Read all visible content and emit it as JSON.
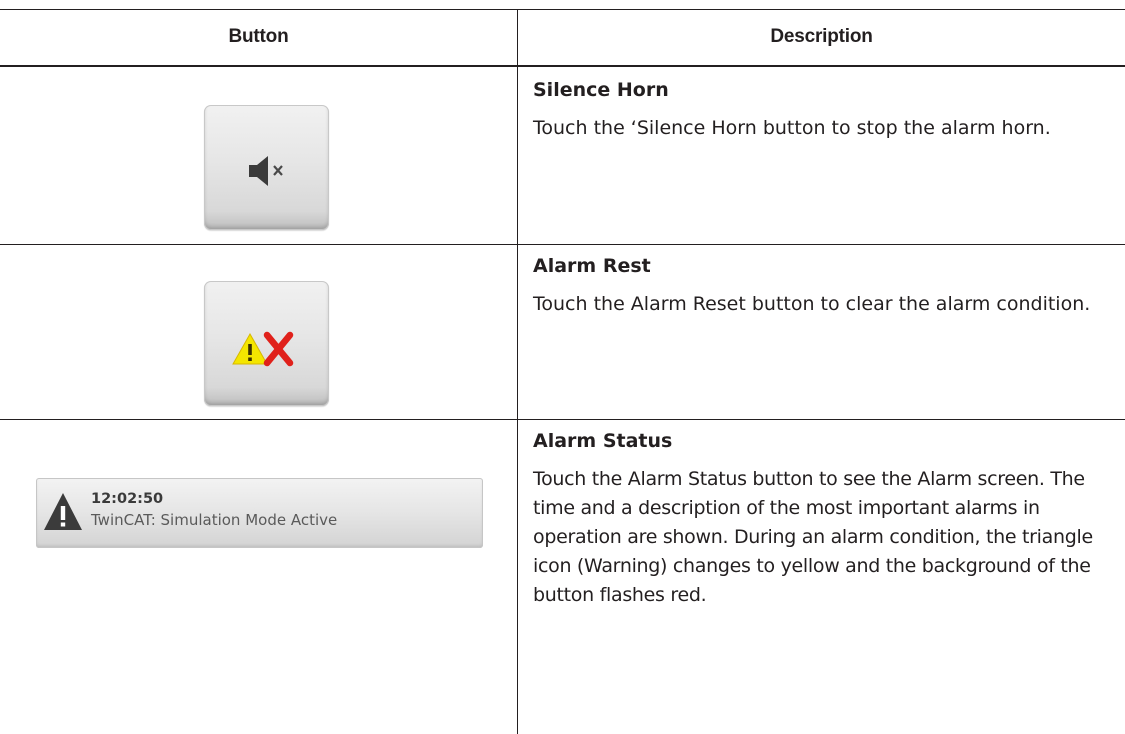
{
  "table": {
    "headers": {
      "button": "Button",
      "description": "Description"
    },
    "rows": [
      {
        "title": "Silence Horn",
        "body": "Touch the ‘Silence Horn button to stop the alarm horn."
      },
      {
        "title": "Alarm Rest",
        "body": "Touch the Alarm Reset button to clear the alarm condition."
      },
      {
        "title": "Alarm Status",
        "body": "Touch the Alarm Status button to see the Alarm screen. The time and a description of the most important alarms in operation are shown. During an alarm condition, the triangle icon (Warning) changes to yellow and the background of the button flashes red."
      }
    ]
  },
  "alarm_status_button": {
    "time": "12:02:50",
    "message": "TwinCAT: Simulation Mode Active"
  },
  "colors": {
    "text": "#231f20",
    "warning_yellow": "#f4e600",
    "reset_red": "#e0211b",
    "icon_dark": "#3b3b3b"
  },
  "icons": {
    "silence_horn": "speaker-muted-icon",
    "alarm_reset": "warning-triangle-with-x-icon",
    "alarm_status": "warning-triangle-icon"
  }
}
